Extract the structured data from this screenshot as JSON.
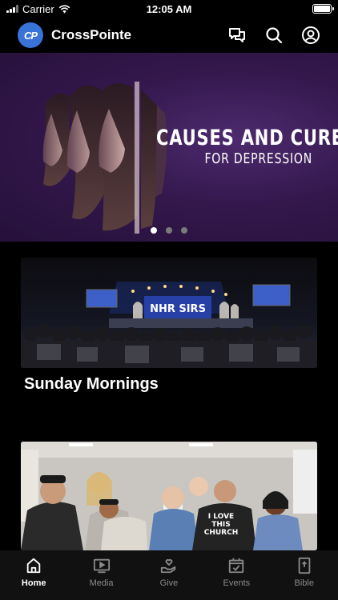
{
  "status": {
    "carrier": "Carrier",
    "time": "12:05 AM"
  },
  "header": {
    "logo_text": "CP",
    "title": "CrossPointe"
  },
  "hero": {
    "line1": "CAUSES AND CURES",
    "line2": "FOR DEPRESSION",
    "slide_count": 3,
    "active_slide": 0
  },
  "cards": [
    {
      "title": "Sunday Mornings",
      "screen_text": "NHR SIRS"
    },
    {
      "title": "",
      "shirt_text": "I LOVE THIS CHURCH"
    }
  ],
  "tabs": [
    {
      "label": "Home",
      "icon": "home-icon",
      "active": true
    },
    {
      "label": "Media",
      "icon": "media-icon",
      "active": false
    },
    {
      "label": "Give",
      "icon": "give-icon",
      "active": false
    },
    {
      "label": "Events",
      "icon": "events-icon",
      "active": false
    },
    {
      "label": "Bible",
      "icon": "bible-icon",
      "active": false
    }
  ],
  "colors": {
    "background": "#000000",
    "accent": "#3a73d8",
    "hero_purple": "#34184d",
    "tab_inactive": "#8a8a8a"
  }
}
